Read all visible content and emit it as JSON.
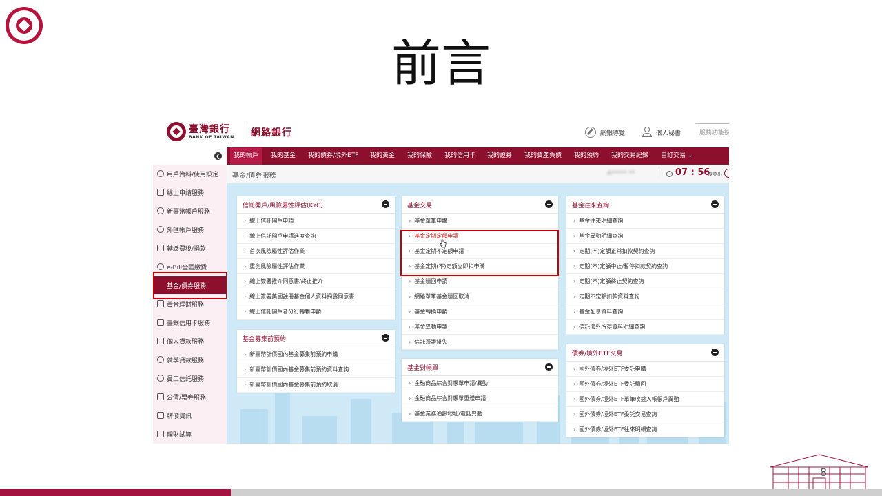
{
  "slide": {
    "title": "前言",
    "page_number": "8"
  },
  "header": {
    "bank_name_zh": "臺灣銀行",
    "bank_name_en": "BANK OF TAIWAN",
    "site_title": "網路銀行",
    "guide_label": "網銀導覽",
    "secretary_label": "個人秘書",
    "search_placeholder": "服務功能搜"
  },
  "nav": {
    "items": [
      "我的帳戶",
      "我的基金",
      "我的債券/境外ETF",
      "我的黃金",
      "我的保險",
      "我的信用卡",
      "我的證券",
      "我的資產負債",
      "我的預約",
      "我的交易紀錄",
      "自訂交易 ⌄"
    ],
    "active_index": 0
  },
  "sidebar": {
    "items": [
      {
        "label": "用戶資料/使用設定",
        "icon": "gear-icon"
      },
      {
        "label": "線上申請服務",
        "icon": "edit-icon"
      },
      {
        "label": "新臺幣帳戶服務",
        "icon": "dollar-icon"
      },
      {
        "label": "外匯帳戶服務",
        "icon": "location-icon"
      },
      {
        "label": "轉繳費稅/捐款",
        "icon": "folder-icon"
      },
      {
        "label": "e-Bill全國繳費",
        "icon": "globe-icon"
      },
      {
        "label": "基金/債券服務",
        "icon": "fund-icon"
      },
      {
        "label": "黃金理財服務",
        "icon": "grid-icon"
      },
      {
        "label": "臺銀信用卡服務",
        "icon": "card-icon"
      },
      {
        "label": "個人貸款服務",
        "icon": "document-icon"
      },
      {
        "label": "就學貸款服務",
        "icon": "graduation-icon"
      },
      {
        "label": "員工信託服務",
        "icon": "people-icon"
      },
      {
        "label": "公債/票券服務",
        "icon": "bond-icon"
      },
      {
        "label": "牌價資訊",
        "icon": "chart-icon"
      },
      {
        "label": "理財試算",
        "icon": "calculator-icon"
      }
    ],
    "active_index": 6
  },
  "status": {
    "breadcrumb": "基金/債券服務",
    "user_name": "A***** **",
    "separator": "|",
    "timer": "07 : 56",
    "logout_label": "後登出"
  },
  "panels": {
    "kyc": {
      "title": "信託開戶/風險屬性評估(KYC)",
      "items": [
        "線上信託開戶申請",
        "線上信託開戶申請進度查詢",
        "首次風險屬性評估作業",
        "重測風險屬性評估作業",
        "線上簽署推介同意書/終止推介",
        "線上簽署美國註冊基金個人資料揭露同意書",
        "線上信託開戶者分行轉籍申請"
      ]
    },
    "presale": {
      "title": "基金募集前預約",
      "items": [
        "新臺幣計價國內基金募集前預約申購",
        "新臺幣計價國內基金募集前預約資料查詢",
        "新臺幣計價國內基金募集前預約取消"
      ]
    },
    "fund_trade": {
      "title": "基金交易",
      "items": [
        "基金單筆申購",
        "基金定期定額申請",
        "基金定期不定額申請",
        "基金定期(不)定額立即扣申購",
        "基金贖回申請",
        "網路單筆基金贖回取消",
        "基金轉換申請",
        "基金異動申請",
        "信託憑證掛失"
      ],
      "highlighted_index": 1
    },
    "statement": {
      "title": "基金對帳單",
      "items": [
        "金融商品綜合對帳單申請/異動",
        "金融商品綜合對帳單重送申請",
        "基金業務通訊地址/電話異動"
      ]
    },
    "fund_query": {
      "title": "基金往來查詢",
      "items": [
        "基金往來明細查詢",
        "基金異動明細查詢",
        "定期(不)定額正常扣款契約查詢",
        "定期(不)定額中止/暫停扣款契約查詢",
        "定期(不)定額終止契約查詢",
        "定期不定額扣款資料查詢",
        "基金配息資料查詢",
        "信託海外所得資料明細查詢"
      ]
    },
    "bond_etf": {
      "title": "債券/境外ETF交易",
      "items": [
        "國外債券/境外ETF委託申購",
        "國外債券/境外ETF委託贖回",
        "國外債券/境外ETF單筆收益入帳帳戶異動",
        "國外債券/境外ETF委託交易查詢",
        "國外債券/境外ETF往來明細查詢"
      ]
    }
  },
  "colors": {
    "brand": "#8c0f2e",
    "slide_accent": "#a4123f",
    "highlight_box": "#cc0000",
    "content_bg": "#cfe9f6"
  }
}
